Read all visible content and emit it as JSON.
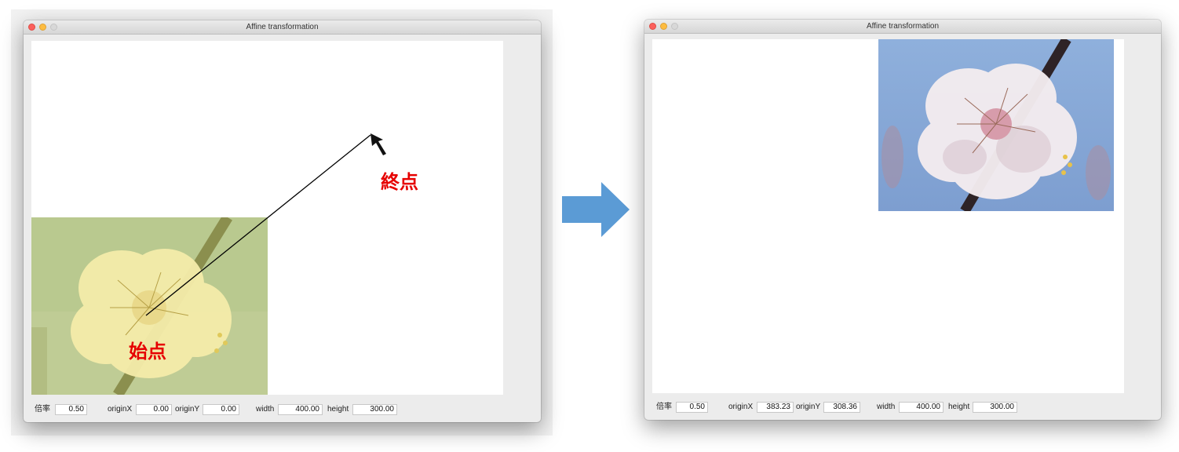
{
  "window_left": {
    "title": "Affine transformation",
    "annotations": {
      "end_label": "終点",
      "start_label": "始点"
    },
    "controls": {
      "scale_label": "倍率",
      "scale_value": "0.50",
      "originx_label": "originX",
      "originx_value": "0.00",
      "originy_label": "originY",
      "originy_value": "0.00",
      "width_label": "width",
      "width_value": "400.00",
      "height_label": "height",
      "height_value": "300.00"
    }
  },
  "window_right": {
    "title": "Affine transformation",
    "controls": {
      "scale_label": "倍率",
      "scale_value": "0.50",
      "originx_label": "originX",
      "originx_value": "383.23",
      "originy_label": "originY",
      "originy_value": "308.36",
      "width_label": "width",
      "width_value": "400.00",
      "height_label": "height",
      "height_value": "300.00"
    }
  },
  "colors": {
    "arrow_blue": "#5b9bd5",
    "annotation_red": "#e60000",
    "sky_blue": "#8fb0dc",
    "faded_green": "#b9c98f"
  },
  "icons": [
    "right-arrow-icon",
    "pointer-arrow-icon",
    "close-light-icon",
    "minimize-light-icon",
    "maximize-light-icon"
  ]
}
